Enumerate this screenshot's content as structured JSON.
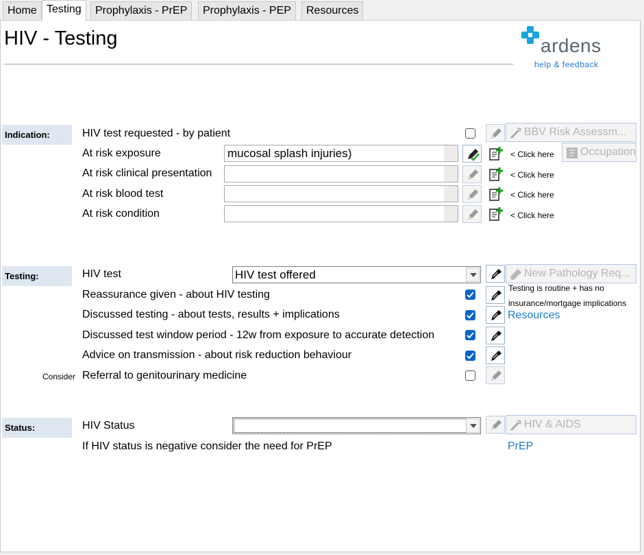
{
  "tabs": [
    {
      "label": "Home"
    },
    {
      "label": "Testing"
    },
    {
      "label": "Prophylaxis - PrEP"
    },
    {
      "label": "Prophylaxis - PEP"
    },
    {
      "label": "Resources"
    }
  ],
  "header": {
    "title": "HIV - Testing",
    "logo_text": "ardens",
    "help_link": "help & feedback"
  },
  "indication": {
    "section_label": "Indication:",
    "rows": [
      {
        "label": "HIV test requested - by patient",
        "checked": false
      },
      {
        "label": "At risk exposure",
        "value": "mucosal splash injuries)",
        "click_here": "< Click here"
      },
      {
        "label": "At risk clinical presentation",
        "value": "",
        "click_here": "< Click here"
      },
      {
        "label": "At risk blood test",
        "value": "",
        "click_here": "< Click here"
      },
      {
        "label": "At risk condition",
        "value": "",
        "click_here": "< Click here"
      }
    ],
    "bbv_button": "BBV Risk Assessm...",
    "occupation_button": "Occupation"
  },
  "testing": {
    "section_label": "Testing:",
    "hiv_test_label": "HIV test",
    "hiv_test_value": "HIV test offered",
    "pathology_button": "New Pathology Req...",
    "note_line1": "Testing is routine + has no",
    "note_line2": "insurance/mortgage implications",
    "resources_link": "Resources",
    "rows": [
      {
        "label": "Reassurance given - about HIV testing",
        "checked": true
      },
      {
        "label": "Discussed testing - about tests, results + implications",
        "checked": true
      },
      {
        "label": "Discussed test window period - 12w from exposure to accurate detection",
        "checked": true
      },
      {
        "label": "Advice on transmission - about risk reduction behaviour",
        "checked": true
      },
      {
        "label": "Referral to genitourinary medicine",
        "checked": false
      }
    ],
    "consider_label": "Consider"
  },
  "status": {
    "section_label": "Status:",
    "hiv_status_label": "HIV Status",
    "hiv_status_value": "",
    "hiv_aids_button": "HIV & AIDS",
    "prep_note": "If HIV status is negative consider the need for PrEP",
    "prep_link": "PrEP"
  },
  "colors": {
    "accent_blue": "#1f7ad1",
    "checkbox_blue": "#0a63c8",
    "section_bg": "#dde6f1",
    "logo_cross": "#1aa3e0"
  }
}
